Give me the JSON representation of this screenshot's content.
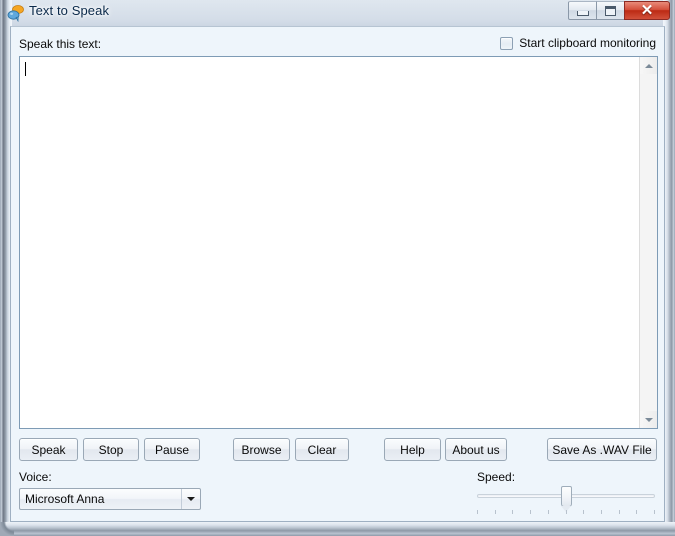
{
  "window": {
    "title": "Text to Speak",
    "icon": "speech-bubbles-icon",
    "controls": {
      "minimize_label": "Minimize",
      "maximize_label": "Maximize",
      "close_label": "✕"
    }
  },
  "main": {
    "text_label": "Speak this text:",
    "clipboard_checkbox": {
      "label": "Start clipboard monitoring",
      "checked": false
    },
    "textarea": {
      "value": "",
      "placeholder": ""
    },
    "scrollbar": {
      "up_icon": "scroll-up-arrow-icon",
      "down_icon": "scroll-down-arrow-icon"
    }
  },
  "buttons": {
    "speak": "Speak",
    "stop": "Stop",
    "pause": "Pause",
    "browse": "Browse",
    "clear": "Clear",
    "help": "Help",
    "about": "About us",
    "save_wav": "Save As .WAV File"
  },
  "voice": {
    "label": "Voice:",
    "selected": "Microsoft Anna",
    "options": [
      "Microsoft Anna"
    ],
    "arrow_icon": "chevron-down-icon"
  },
  "speed": {
    "label": "Speed:",
    "value": 5,
    "min": 0,
    "max": 10,
    "tick_count": 11
  },
  "colors": {
    "client_background": "#eef5fb",
    "title_text": "#0b2a4a",
    "close_button": "#bc2a14",
    "textarea_border": "#7e9bb5"
  }
}
